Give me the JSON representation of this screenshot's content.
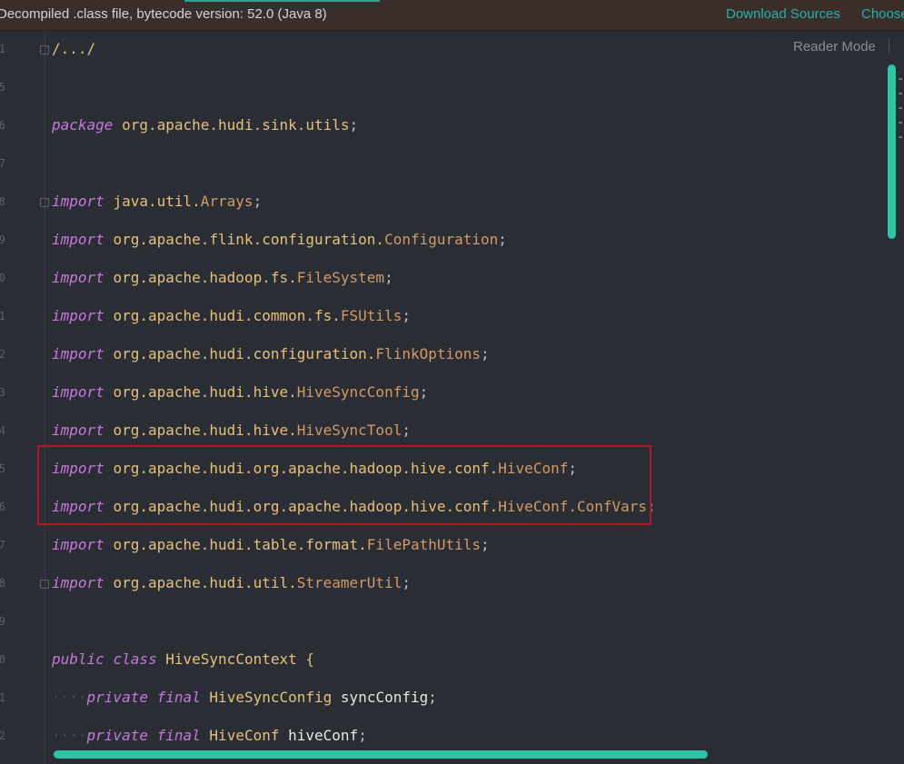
{
  "banner": {
    "message": "Decompiled .class file, bytecode version: 52.0 (Java 8)",
    "download_sources": "Download Sources",
    "choose_sources": "Choose"
  },
  "editor": {
    "reader_mode": "Reader Mode",
    "line_numbers": [
      "1",
      "5",
      "6",
      "7",
      "8",
      "9",
      "0",
      "1",
      "2",
      "3",
      "4",
      "5",
      "6",
      "7",
      "8",
      "9",
      "0",
      "1",
      "2"
    ],
    "lines": {
      "fold": "/.../",
      "package": {
        "kw": "package",
        "name": "org.apache.hudi.sink.utils",
        "semi": ";"
      },
      "imports": [
        {
          "kw": "import",
          "pkg": "java.util.",
          "cls": "Arrays"
        },
        {
          "kw": "import",
          "pkg": "org.apache.flink.configuration.",
          "cls": "Configuration"
        },
        {
          "kw": "import",
          "pkg": "org.apache.hadoop.fs.",
          "cls": "FileSystem"
        },
        {
          "kw": "import",
          "pkg": "org.apache.hudi.common.fs.",
          "cls": "FSUtils"
        },
        {
          "kw": "import",
          "pkg": "org.apache.hudi.configuration.",
          "cls": "FlinkOptions"
        },
        {
          "kw": "import",
          "pkg": "org.apache.hudi.hive.",
          "cls": "HiveSyncConfig"
        },
        {
          "kw": "import",
          "pkg": "org.apache.hudi.hive.",
          "cls": "HiveSyncTool"
        },
        {
          "kw": "import",
          "pkg": "org.apache.hudi.org.apache.hadoop.hive.conf.",
          "cls": "HiveConf"
        },
        {
          "kw": "import",
          "pkg": "org.apache.hudi.org.apache.hadoop.hive.conf.",
          "cls": "HiveConf.ConfVars"
        },
        {
          "kw": "import",
          "pkg": "org.apache.hudi.table.format.",
          "cls": "FilePathUtils"
        },
        {
          "kw": "import",
          "pkg": "org.apache.hudi.util.",
          "cls": "StreamerUtil"
        }
      ],
      "class_decl": {
        "kw1": "public",
        "kw2": "class",
        "name": "HiveSyncContext",
        "brace": "{"
      },
      "fields": [
        {
          "indent": "····",
          "kw1": "private",
          "kw2": "final",
          "type": "HiveSyncConfig",
          "name": "syncConfig"
        },
        {
          "indent": "····",
          "kw1": "private",
          "kw2": "final",
          "type": "HiveConf",
          "name": "hiveConf"
        }
      ]
    }
  },
  "colors": {
    "background": "#2b2d35",
    "keyword": "#c678dd",
    "package": "#e5c07b",
    "class": "#d19a66",
    "accent": "#2ec4a6",
    "highlight": "#b0182a"
  }
}
